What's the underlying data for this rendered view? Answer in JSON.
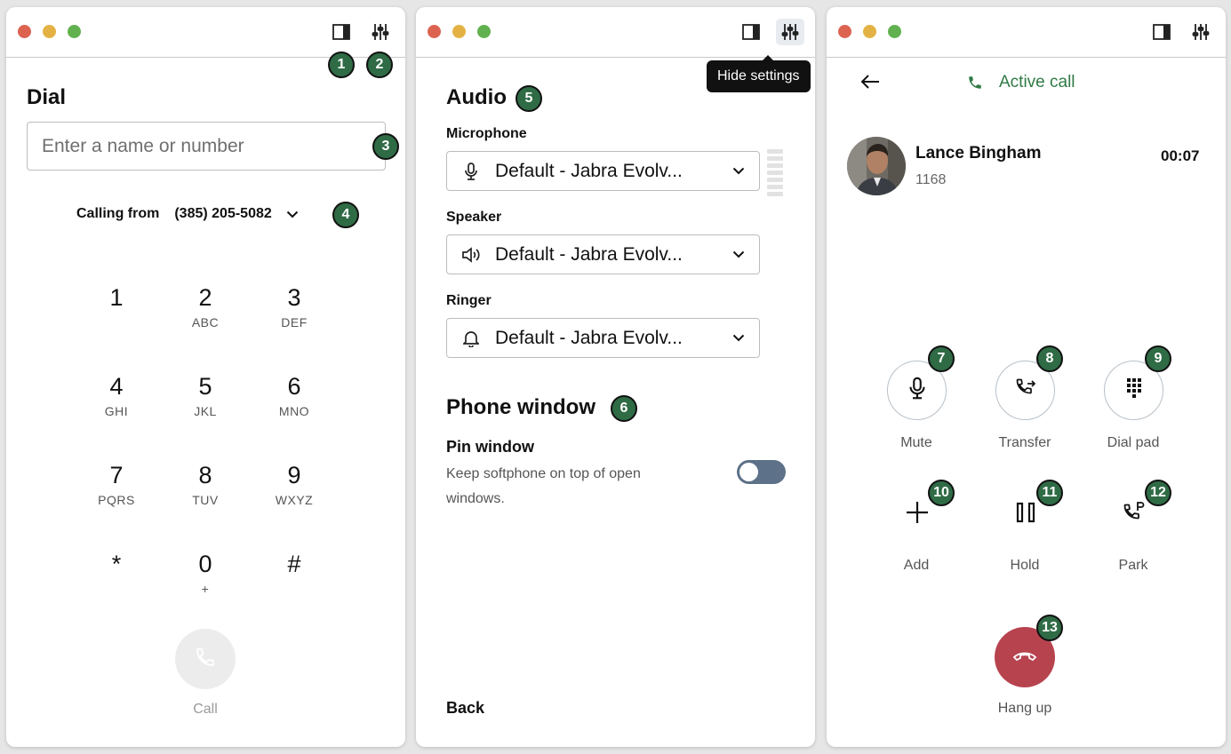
{
  "badges": [
    "1",
    "2",
    "3",
    "4",
    "5",
    "6",
    "7",
    "8",
    "9",
    "10",
    "11",
    "12",
    "13"
  ],
  "dial": {
    "title": "Dial",
    "input_placeholder": "Enter a name or number",
    "input_value": "",
    "calling_from_label": "Calling from",
    "calling_from_number": "(385) 205-5082",
    "keys": [
      {
        "digit": "1",
        "letters": ""
      },
      {
        "digit": "2",
        "letters": "ABC"
      },
      {
        "digit": "3",
        "letters": "DEF"
      },
      {
        "digit": "4",
        "letters": "GHI"
      },
      {
        "digit": "5",
        "letters": "JKL"
      },
      {
        "digit": "6",
        "letters": "MNO"
      },
      {
        "digit": "7",
        "letters": "PQRS"
      },
      {
        "digit": "8",
        "letters": "TUV"
      },
      {
        "digit": "9",
        "letters": "WXYZ"
      },
      {
        "digit": "*",
        "letters": ""
      },
      {
        "digit": "0",
        "letters": "+"
      },
      {
        "digit": "#",
        "letters": ""
      }
    ],
    "call_label": "Call"
  },
  "settings": {
    "tooltip": "Hide settings",
    "audio_title": "Audio",
    "microphone_label": "Microphone",
    "microphone_value": "Default - Jabra Evolv...",
    "speaker_label": "Speaker",
    "speaker_value": "Default - Jabra Evolv...",
    "ringer_label": "Ringer",
    "ringer_value": "Default - Jabra Evolv...",
    "phone_window_title": "Phone window",
    "pin_label": "Pin window",
    "pin_desc": "Keep softphone on top of open windows.",
    "pin_enabled": false,
    "back_label": "Back"
  },
  "call": {
    "status": "Active call",
    "caller_name": "Lance Bingham",
    "caller_ext": "1168",
    "timer": "00:07",
    "buttons": {
      "mute": "Mute",
      "transfer": "Transfer",
      "dialpad": "Dial pad",
      "add": "Add",
      "hold": "Hold",
      "park": "Park",
      "hangup": "Hang up"
    }
  },
  "colors": {
    "badge": "#2f6b45",
    "active_green": "#2f7a45",
    "hangup_red": "#b7434f",
    "toggle_off": "#5d7188"
  }
}
